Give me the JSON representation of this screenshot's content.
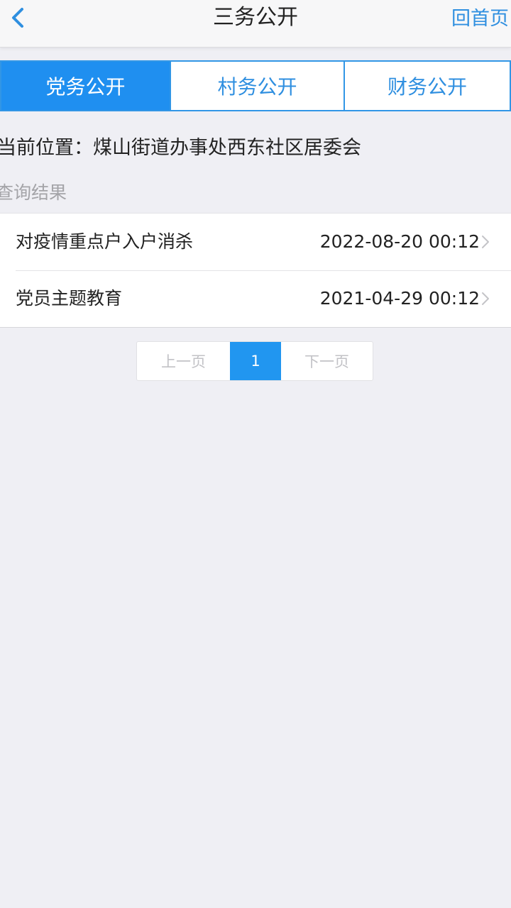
{
  "navbar": {
    "title": "三务公开",
    "home_label": "回首页"
  },
  "tabs": [
    {
      "label": "党务公开",
      "active": true
    },
    {
      "label": "村务公开",
      "active": false
    },
    {
      "label": "财务公开",
      "active": false
    }
  ],
  "location_text": "当前位置：煤山街道办事处西东社区居委会",
  "result_label": "查询结果",
  "results": [
    {
      "title": "对疫情重点户入户消杀",
      "date": "2022-08-20 00:12"
    },
    {
      "title": "党员主题教育",
      "date": "2021-04-29 00:12"
    }
  ],
  "pagination": {
    "prev_label": "上一页",
    "current_page": "1",
    "next_label": "下一页"
  },
  "colors": {
    "accent": "#2196f0",
    "background": "#efeff4",
    "muted": "#a4a4a8"
  },
  "icons": {
    "back": "chevron-left-icon",
    "row": "chevron-right-icon"
  }
}
